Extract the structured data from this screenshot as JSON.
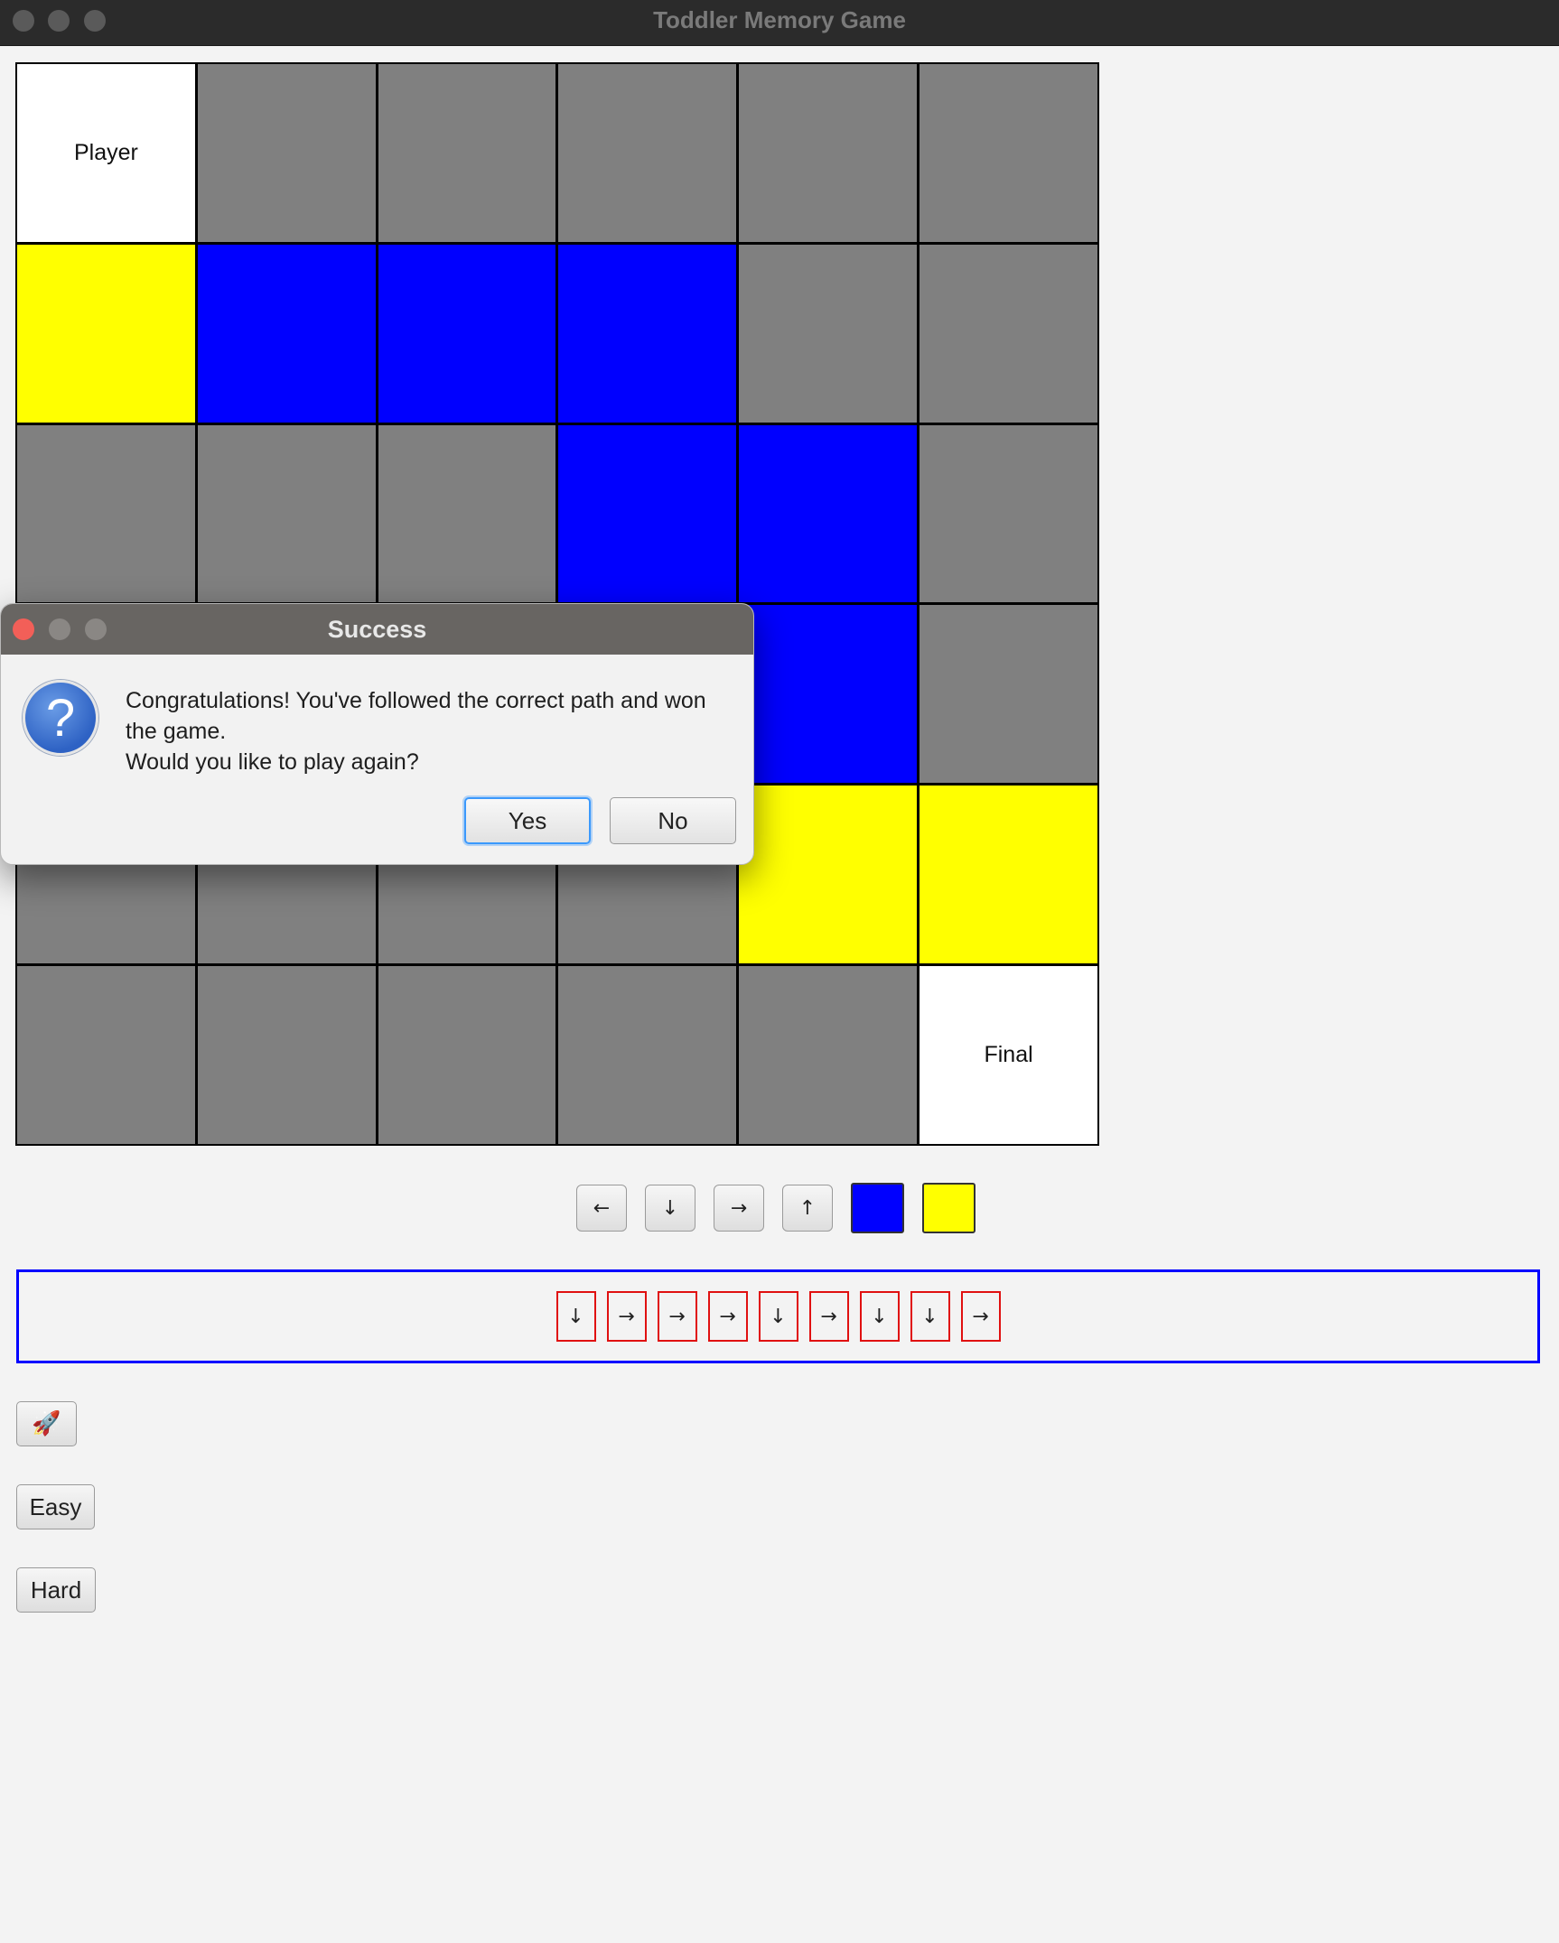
{
  "window": {
    "title": "Toddler Memory Game"
  },
  "grid": {
    "rows": 6,
    "cols": 6,
    "cells": [
      [
        {
          "color": "white",
          "label": "Player"
        },
        {
          "color": "gray",
          "label": ""
        },
        {
          "color": "gray",
          "label": ""
        },
        {
          "color": "gray",
          "label": ""
        },
        {
          "color": "gray",
          "label": ""
        },
        {
          "color": "gray",
          "label": ""
        }
      ],
      [
        {
          "color": "yellow",
          "label": ""
        },
        {
          "color": "blue",
          "label": ""
        },
        {
          "color": "blue",
          "label": ""
        },
        {
          "color": "blue",
          "label": ""
        },
        {
          "color": "gray",
          "label": ""
        },
        {
          "color": "gray",
          "label": ""
        }
      ],
      [
        {
          "color": "gray",
          "label": ""
        },
        {
          "color": "gray",
          "label": ""
        },
        {
          "color": "gray",
          "label": ""
        },
        {
          "color": "blue",
          "label": ""
        },
        {
          "color": "blue",
          "label": ""
        },
        {
          "color": "gray",
          "label": ""
        }
      ],
      [
        {
          "color": "gray",
          "label": ""
        },
        {
          "color": "gray",
          "label": ""
        },
        {
          "color": "gray",
          "label": ""
        },
        {
          "color": "gray",
          "label": ""
        },
        {
          "color": "blue",
          "label": ""
        },
        {
          "color": "gray",
          "label": ""
        }
      ],
      [
        {
          "color": "gray",
          "label": ""
        },
        {
          "color": "gray",
          "label": ""
        },
        {
          "color": "gray",
          "label": ""
        },
        {
          "color": "gray",
          "label": ""
        },
        {
          "color": "yellow",
          "label": ""
        },
        {
          "color": "yellow",
          "label": ""
        }
      ],
      [
        {
          "color": "gray",
          "label": ""
        },
        {
          "color": "gray",
          "label": ""
        },
        {
          "color": "gray",
          "label": ""
        },
        {
          "color": "gray",
          "label": ""
        },
        {
          "color": "gray",
          "label": ""
        },
        {
          "color": "white",
          "label": "Final"
        }
      ]
    ]
  },
  "controls": {
    "arrows": [
      {
        "name": "left-arrow-button",
        "glyph": "←"
      },
      {
        "name": "down-arrow-button",
        "glyph": "↓"
      },
      {
        "name": "right-arrow-button",
        "glyph": "→"
      },
      {
        "name": "up-arrow-button",
        "glyph": "↑"
      }
    ],
    "colors": [
      {
        "name": "blue-color-button",
        "color": "#0000ff"
      },
      {
        "name": "yellow-color-button",
        "color": "#ffff00"
      }
    ]
  },
  "sequence": [
    "↓",
    "→",
    "→",
    "→",
    "↓",
    "→",
    "↓",
    "↓",
    "→"
  ],
  "side_buttons": {
    "rocket_icon": "🚀",
    "easy_label": "Easy",
    "hard_label": "Hard"
  },
  "dialog": {
    "title": "Success",
    "message_line1": "Congratulations! You've followed the correct path and won the game.",
    "message_line2": "Would you like to play again?",
    "yes_label": "Yes",
    "no_label": "No",
    "icon": "question-icon",
    "icon_glyph": "?"
  },
  "colors": {
    "blue": "#0000ff",
    "yellow": "#ffff00",
    "gray": "#808080",
    "white": "#ffffff",
    "sequence_border": "#0000ff",
    "sequence_item_border": "#e01010"
  }
}
